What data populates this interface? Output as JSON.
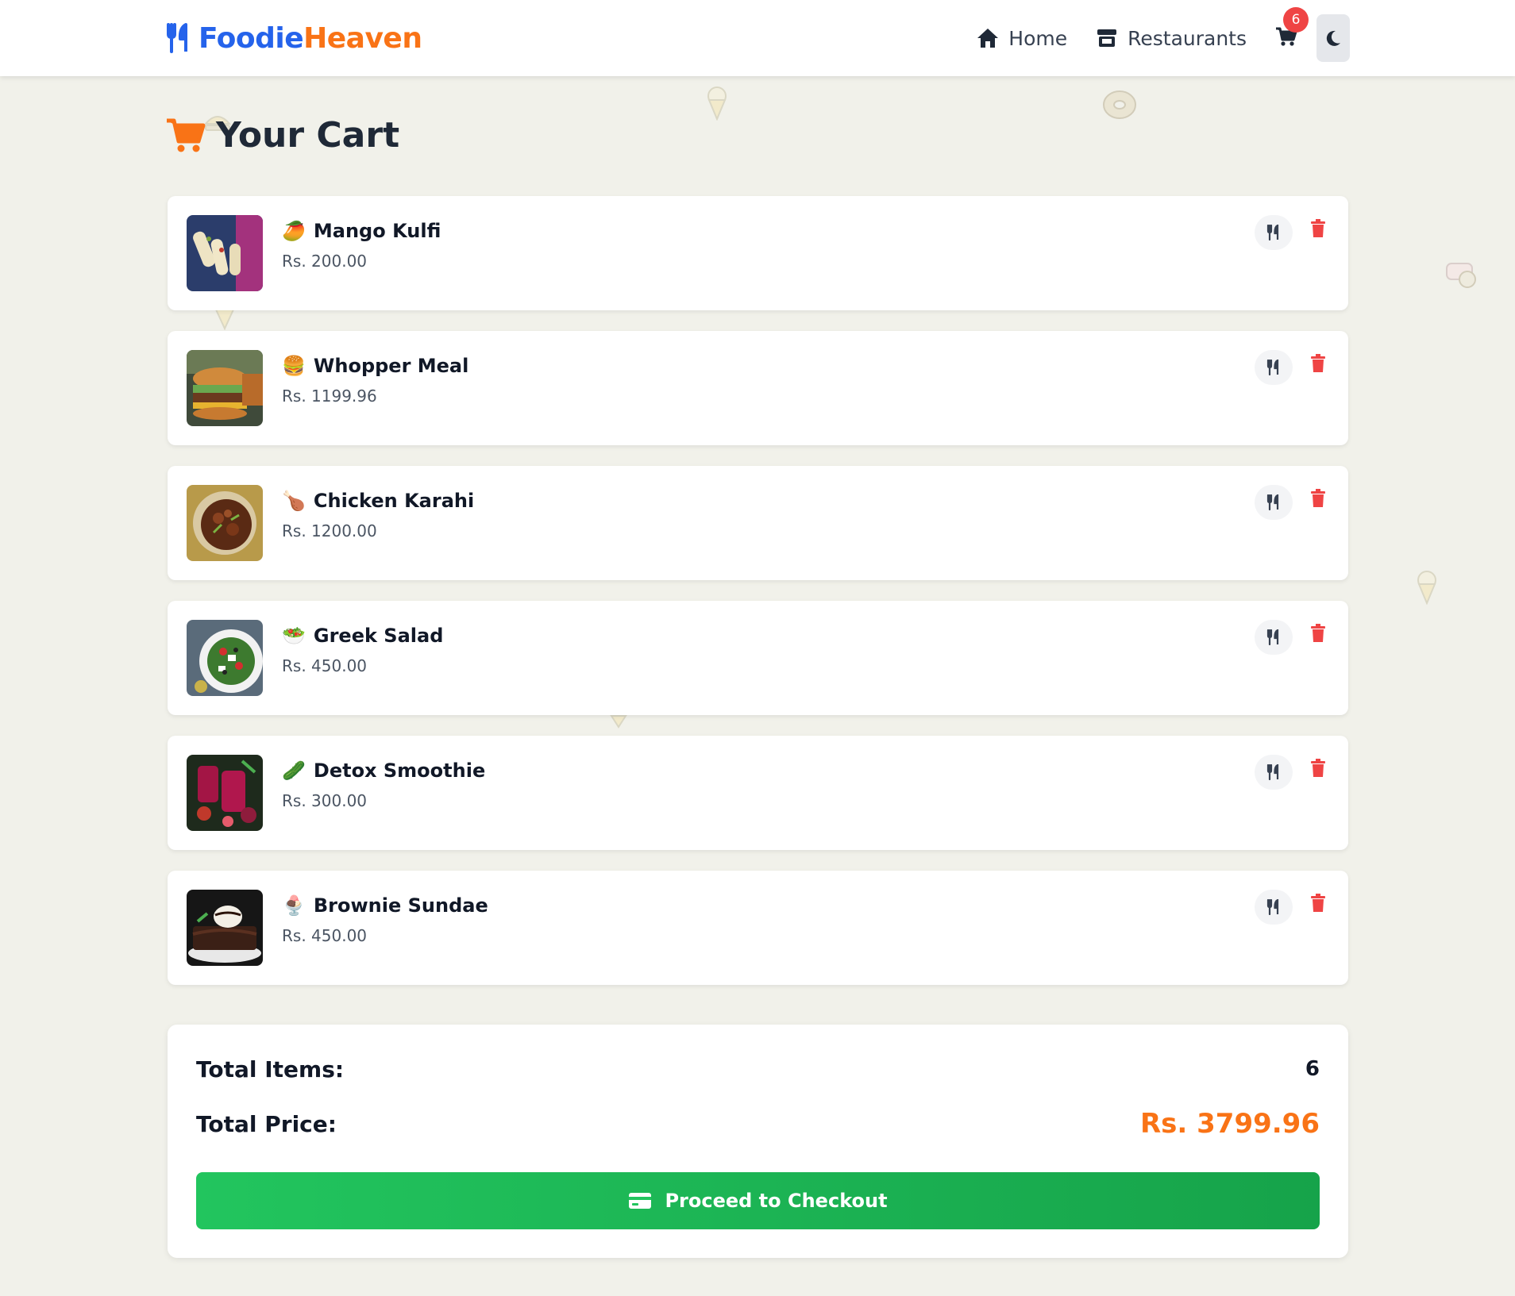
{
  "brand": {
    "part1": "Foodie",
    "part2": "Heaven"
  },
  "nav": {
    "home_label": "Home",
    "restaurants_label": "Restaurants",
    "cart_count": "6"
  },
  "page": {
    "title": "Your Cart"
  },
  "cart": {
    "items": [
      {
        "name": "Mango Kulfi",
        "price": "Rs. 200.00",
        "emoji": "🥭"
      },
      {
        "name": "Whopper Meal",
        "price": "Rs. 1199.96",
        "emoji": "🍔"
      },
      {
        "name": "Chicken Karahi",
        "price": "Rs. 1200.00",
        "emoji": "🍗"
      },
      {
        "name": "Greek Salad",
        "price": "Rs. 450.00",
        "emoji": "🥗"
      },
      {
        "name": "Detox Smoothie",
        "price": "Rs. 300.00",
        "emoji": "🥒"
      },
      {
        "name": "Brownie Sundae",
        "price": "Rs. 450.00",
        "emoji": "🍨"
      }
    ]
  },
  "summary": {
    "total_items_label": "Total Items:",
    "total_items_value": "6",
    "total_price_label": "Total Price:",
    "total_price_value": "Rs. 3799.96",
    "checkout_label": "Proceed to Checkout"
  },
  "colors": {
    "brand_blue": "#2563eb",
    "accent_orange": "#f97316",
    "danger_red": "#ef4444",
    "checkout_green": "#22c55e"
  }
}
